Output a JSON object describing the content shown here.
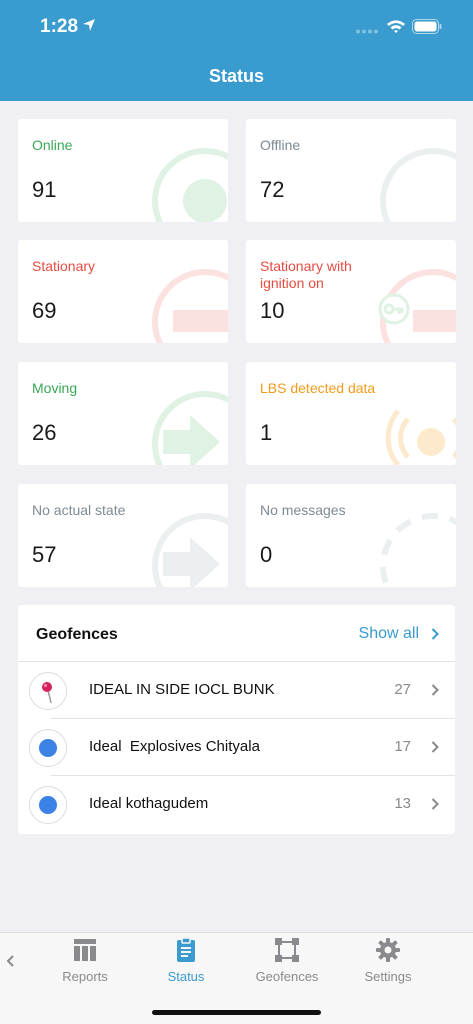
{
  "status_bar": {
    "time": "1:28"
  },
  "header": {
    "title": "Status"
  },
  "cards": [
    {
      "label": "Online",
      "value": "91"
    },
    {
      "label": "Offline",
      "value": "72"
    },
    {
      "label": "Stationary",
      "value": "69"
    },
    {
      "label": "Stationary with ignition on",
      "value": "10"
    },
    {
      "label": "Moving",
      "value": "26"
    },
    {
      "label": "LBS detected data",
      "value": "1"
    },
    {
      "label": "No actual state",
      "value": "57"
    },
    {
      "label": "No messages",
      "value": "0"
    }
  ],
  "geofences": {
    "title": "Geofences",
    "show_all": "Show all",
    "items": [
      {
        "name": "IDEAL IN SIDE IOCL BUNK",
        "count": "27",
        "icon": "pin-icon"
      },
      {
        "name": "Ideal  Explosives Chityala",
        "count": "17",
        "icon": "blue-dot-icon"
      },
      {
        "name": "Ideal kothagudem",
        "count": "13",
        "icon": "blue-dot-icon"
      }
    ]
  },
  "tabs": [
    {
      "label": "Reports",
      "icon": "reports-icon"
    },
    {
      "label": "Status",
      "icon": "clipboard-icon",
      "active": true
    },
    {
      "label": "Geofences",
      "icon": "geofence-square-icon"
    },
    {
      "label": "Settings",
      "icon": "gear-icon"
    }
  ],
  "colors": {
    "header": "#3a9bce",
    "green": "#3aa757",
    "red": "#e84b42",
    "orange": "#f39b1b",
    "gray": "#7d8a93"
  }
}
